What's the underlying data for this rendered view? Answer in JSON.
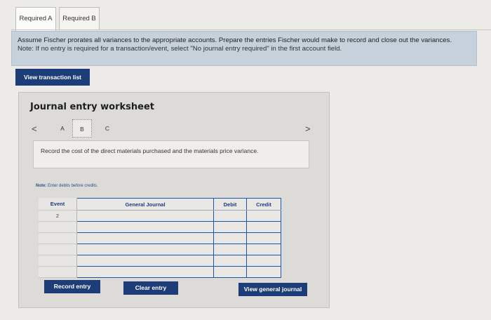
{
  "tabs": [
    {
      "label": "Required A"
    },
    {
      "label": "Required B"
    }
  ],
  "instructions": {
    "text": "Assume Fischer prorates all variances to the appropriate accounts. Prepare the entries Fischer would make to record and close out the variances.",
    "note": "Note: If no entry is required for a transaction/event, select \"No journal entry required\" in the first account field."
  },
  "buttons": {
    "view_transaction_list": "View transaction list",
    "record_entry": "Record entry",
    "clear_entry": "Clear entry",
    "view_general_journal": "View general journal"
  },
  "worksheet": {
    "title": "Journal entry worksheet",
    "nav_prev": "<",
    "nav_next": ">",
    "pages": [
      "A",
      "B",
      "C"
    ],
    "active_page": "B",
    "description": "Record the cost of the direct materials purchased and the materials price variance.",
    "note_lead": "Note:",
    "note_text": "Enter debits before credits."
  },
  "journal": {
    "headers": {
      "event": "Event",
      "account": "General Journal",
      "debit": "Debit",
      "credit": "Credit"
    },
    "rows": [
      {
        "event": "2",
        "account": "",
        "debit": "",
        "credit": ""
      },
      {
        "event": "",
        "account": "",
        "debit": "",
        "credit": ""
      },
      {
        "event": "",
        "account": "",
        "debit": "",
        "credit": ""
      },
      {
        "event": "",
        "account": "",
        "debit": "",
        "credit": ""
      },
      {
        "event": "",
        "account": "",
        "debit": "",
        "credit": ""
      },
      {
        "event": "",
        "account": "",
        "debit": "",
        "credit": ""
      }
    ]
  },
  "colors": {
    "accent": "#1d3d78",
    "instruction_bg": "#c6d1dc",
    "grid_border": "#1f55a8"
  }
}
